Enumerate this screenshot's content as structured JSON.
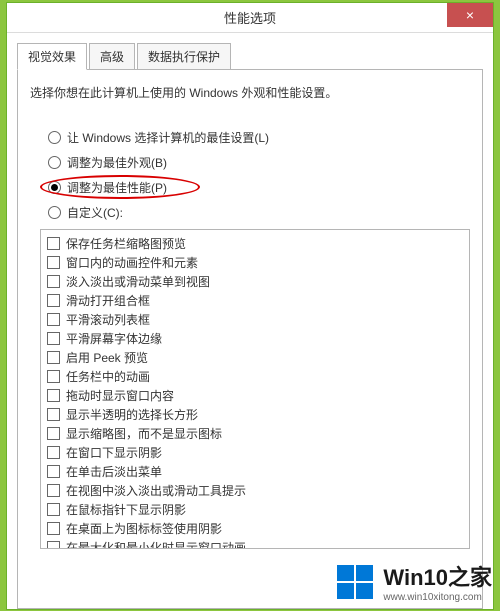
{
  "window": {
    "title": "性能选项",
    "close_label": "×"
  },
  "tabs": {
    "visual": "视觉效果",
    "advanced": "高级",
    "dep": "数据执行保护"
  },
  "panel": {
    "description": "选择你想在此计算机上使用的 Windows 外观和性能设置。"
  },
  "radios": {
    "auto": "让 Windows 选择计算机的最佳设置(L)",
    "best_appearance": "调整为最佳外观(B)",
    "best_performance": "调整为最佳性能(P)",
    "custom": "自定义(C):"
  },
  "checks": [
    "保存任务栏缩略图预览",
    "窗口内的动画控件和元素",
    "淡入淡出或滑动菜单到视图",
    "滑动打开组合框",
    "平滑滚动列表框",
    "平滑屏幕字体边缘",
    "启用 Peek 预览",
    "任务栏中的动画",
    "拖动时显示窗口内容",
    "显示半透明的选择长方形",
    "显示缩略图，而不是显示图标",
    "在窗口下显示阴影",
    "在单击后淡出菜单",
    "在视图中淡入淡出或滑动工具提示",
    "在鼠标指针下显示阴影",
    "在桌面上为图标标签使用阴影",
    "在最大化和最小化时显示窗口动画"
  ],
  "watermark": {
    "title": "Win10之家",
    "url": "www.win10xitong.com"
  }
}
